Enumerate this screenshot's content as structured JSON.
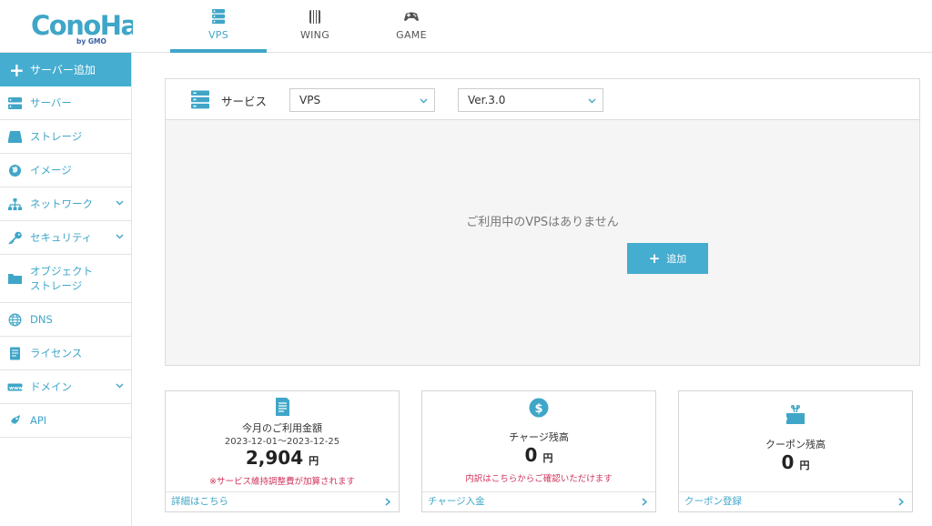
{
  "brand": {
    "logo_text": "ConoHa",
    "logo_sub": "by GMO"
  },
  "topnav": [
    {
      "label": "VPS",
      "icon": "server-stack-icon",
      "active": true
    },
    {
      "label": "WING",
      "icon": "wing-icon",
      "active": false
    },
    {
      "label": "GAME",
      "icon": "gamepad-icon",
      "active": false
    }
  ],
  "sidebar": {
    "add_label": "サーバー追加",
    "items": [
      {
        "label": "サーバー",
        "icon": "server-icon"
      },
      {
        "label": "ストレージ",
        "icon": "storage-icon"
      },
      {
        "label": "イメージ",
        "icon": "globe-image-icon"
      },
      {
        "label": "ネットワーク",
        "icon": "network-icon",
        "expandable": true
      },
      {
        "label": "セキュリティ",
        "icon": "key-icon",
        "expandable": true
      },
      {
        "label_line1": "オブジェクト",
        "label_line2": "ストレージ",
        "icon": "folder-icon"
      },
      {
        "label": "DNS",
        "icon": "dns-globe-icon"
      },
      {
        "label": "ライセンス",
        "icon": "license-icon"
      },
      {
        "label": "ドメイン",
        "icon": "domain-icon",
        "expandable": true
      },
      {
        "label": "API",
        "icon": "api-icon"
      }
    ]
  },
  "service": {
    "label": "サービス",
    "service_select": "VPS",
    "version_select": "Ver.3.0",
    "empty_message": "ご利用中のVPSはありません",
    "add_button": "追加"
  },
  "cards": {
    "billing": {
      "title": "今月のご利用金額",
      "period": "2023-12-01〜2023-12-25",
      "amount": "2,904",
      "unit": "円",
      "note": "※サービス維持調整費が加算されます",
      "link": "詳細はこちら"
    },
    "charge": {
      "title": "チャージ残高",
      "amount": "0",
      "unit": "円",
      "note": "内訳はこちらからご確認いただけます",
      "link": "チャージ入金"
    },
    "coupon": {
      "title": "クーポン残高",
      "amount": "0",
      "unit": "円",
      "link": "クーポン登録"
    }
  },
  "colors": {
    "accent": "#45add0",
    "link": "#3fa6c8",
    "note": "#d0335c"
  }
}
